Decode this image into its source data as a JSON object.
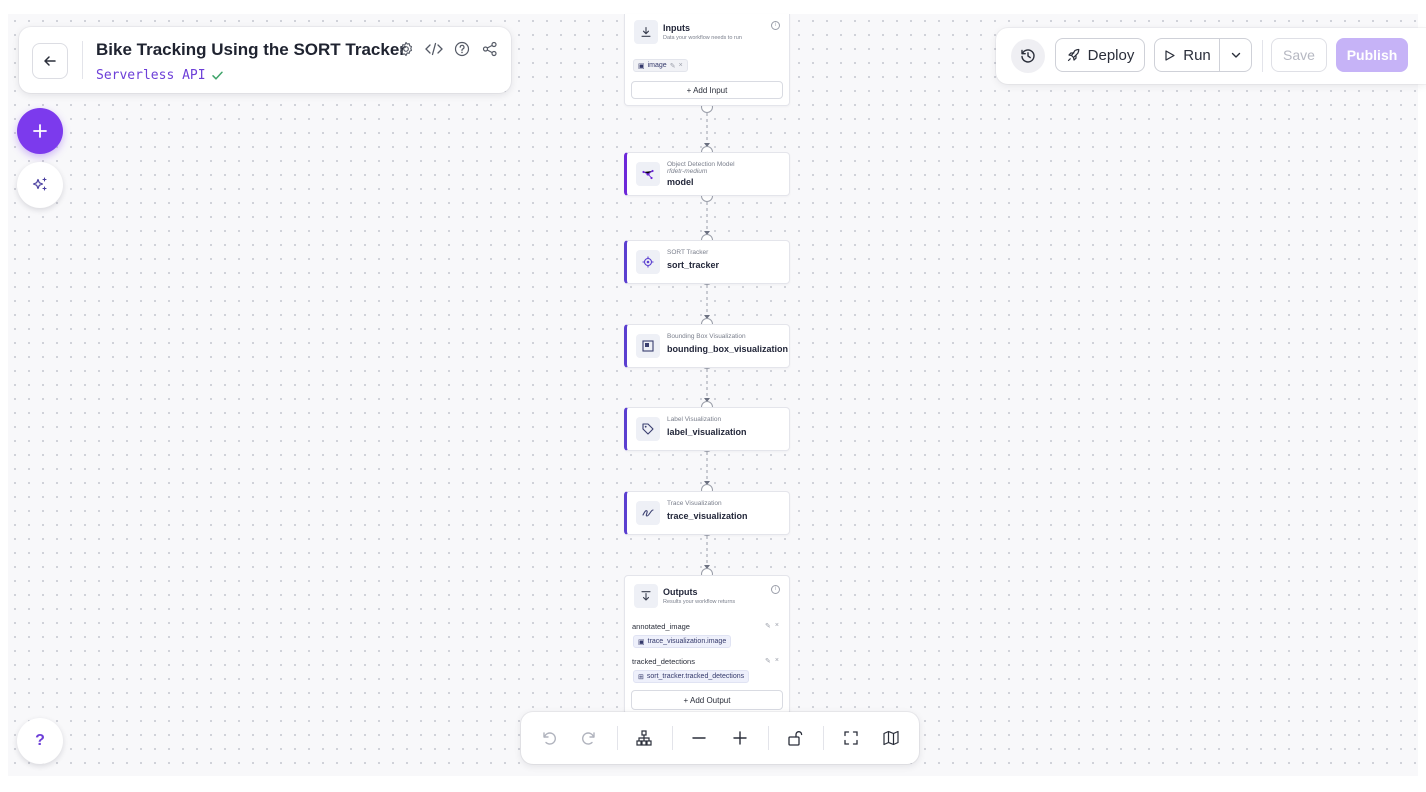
{
  "workflow": {
    "title": "Bike Tracking Using the SORT Tracker",
    "subtitle": "Serverless API"
  },
  "header": {
    "icons": [
      "back-arrow-icon",
      "settings-icon",
      "code-icon",
      "help-circle-icon",
      "share-icon"
    ]
  },
  "toolbar": {
    "deploy_label": "Deploy",
    "run_label": "Run",
    "save_label": "Save",
    "publish_label": "Publish"
  },
  "inputs_node": {
    "title": "Inputs",
    "description": "Data your workflow needs to run",
    "chip": "image",
    "add_label": "+ Add Input"
  },
  "blocks": [
    {
      "type": "Object Detection Model",
      "sub": "rfdetr-medium",
      "name": "model"
    },
    {
      "type": "SORT Tracker",
      "name": "sort_tracker"
    },
    {
      "type": "Bounding Box Visualization",
      "name": "bounding_box_visualization"
    },
    {
      "type": "Label Visualization",
      "name": "label_visualization"
    },
    {
      "type": "Trace Visualization",
      "name": "trace_visualization"
    }
  ],
  "outputs_node": {
    "title": "Outputs",
    "description": "Results your workflow returns",
    "items": [
      {
        "label": "annotated_image",
        "value": "trace_visualization.image"
      },
      {
        "label": "tracked_detections",
        "value": "sort_tracker.tracked_detections"
      }
    ],
    "add_label": "+ Add Output"
  },
  "colors": {
    "accent": "#7c3aed",
    "block_border": "#5b3fd0",
    "publish_disabled": "#c6b3f7",
    "subtitle": "#6d3fd8"
  },
  "help": {
    "label": "?"
  }
}
